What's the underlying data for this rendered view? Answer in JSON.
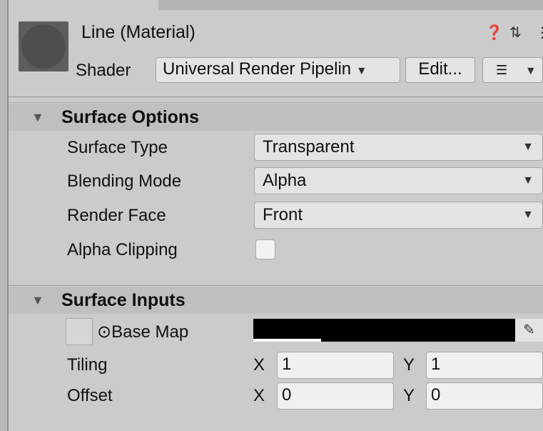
{
  "header": {
    "title": "Line (Material)",
    "help_icon": "question-circle-icon",
    "help_glyph": "❓",
    "settings_icon": "sliders-icon",
    "settings_glyph": "⇅",
    "more_glyph": "⋮",
    "shader_label": "Shader",
    "shader_value": "Universal Render Pipelin",
    "shader_caret": "▼",
    "edit_label": "Edit...",
    "list_glyph": "☰",
    "list_caret": "▼"
  },
  "surface_options": {
    "tri": "▼",
    "title": "Surface Options",
    "surface_type_label": "Surface Type",
    "surface_type_value": "Transparent",
    "blending_mode_label": "Blending Mode",
    "blending_mode_value": "Alpha",
    "render_face_label": "Render Face",
    "render_face_value": "Front",
    "alpha_clipping_label": "Alpha Clipping",
    "alpha_clipping_checked": false,
    "caret": "▼"
  },
  "surface_inputs": {
    "tri": "▼",
    "title": "Surface Inputs",
    "base_map_label": "⊙Base Map",
    "base_map_color": "#000000",
    "picker_glyph": "✎",
    "tiling_label": "Tiling",
    "offset_label": "Offset",
    "x_label": "X",
    "y_label": "Y",
    "tiling_x": "1",
    "tiling_y": "1",
    "offset_x": "0",
    "offset_y": "0"
  }
}
